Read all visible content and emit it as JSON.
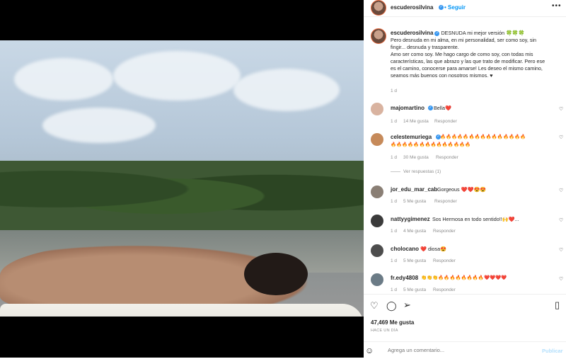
{
  "post": {
    "username": "escuderosilvina",
    "follow_label": "Seguir",
    "more_label": "•••",
    "caption_lines": [
      "DESNUDA mi mejor versión 🍀🍀🍀",
      "Pero desnuda en mi alma, en mi personalidad, ser como soy, sin",
      "fingir... desnuda y trasparente.",
      "Amo ser como soy. Me hago cargo de como soy, con todas mis",
      "características, las que abrazo y las que trato de modificar. Pero ese",
      "es el camino, conocerse para amarse! Les deseo el mismo camino,",
      "seamos más buenos con nosotros mismos. ♥"
    ],
    "caption_time": "1 d"
  },
  "comments": [
    {
      "user": "majomartino",
      "verified": true,
      "text": "Bella❤️",
      "time": "1 d",
      "likes": "14 Me gusta",
      "reply": "Responder",
      "avatar_color": "#d9b3a0"
    },
    {
      "user": "celestemuriega",
      "verified": true,
      "text": "🔥🔥🔥🔥🔥🔥🔥🔥🔥🔥🔥🔥🔥🔥🔥",
      "text2": "🔥🔥🔥🔥🔥🔥🔥🔥🔥🔥🔥🔥🔥🔥",
      "time": "1 d",
      "likes": "30 Me gusta",
      "reply": "Responder",
      "replies_label": "Ver respuestas (1)",
      "avatar_color": "#c68a5a"
    },
    {
      "user": "jor_edu_mar_cab",
      "verified": false,
      "text": "Gorgeous ❤️❤️😍😍",
      "time": "1 d",
      "likes": "5 Me gusta",
      "reply": "Responder",
      "avatar_color": "#8a7f75"
    },
    {
      "user": "nattyygimenez",
      "verified": false,
      "text": "Sos Hermosa en todo sentido!!🙌❤️...",
      "time": "1 d",
      "likes": "4 Me gusta",
      "reply": "Responder",
      "avatar_color": "#3b3b3b"
    },
    {
      "user": "cholocano",
      "verified": false,
      "text": "❤️ diosa😍",
      "time": "1 d",
      "likes": "5 Me gusta",
      "reply": "Responder",
      "avatar_color": "#4d4d4d"
    },
    {
      "user": "fr.edy4808",
      "verified": false,
      "text": "👏👏👏🔥🔥🔥🔥🔥🔥🔥🔥❤️❤️❤️❤️",
      "time": "1 d",
      "likes": "5 Me gusta",
      "reply": "Responder",
      "avatar_color": "#6b7b86"
    }
  ],
  "actions": {
    "like_icon": "heart-icon",
    "comment_icon": "comment-icon",
    "share_icon": "share-icon",
    "save_icon": "bookmark-icon",
    "likes_count": "47,469 Me gusta",
    "time_ago": "HACE UN DÍA"
  },
  "add_comment": {
    "placeholder": "Agrega un comentario...",
    "publish_label": "Publicar"
  },
  "colors": {
    "accent": "#0095f6",
    "verified": "#3897f0",
    "muted": "#8e8e8e"
  }
}
